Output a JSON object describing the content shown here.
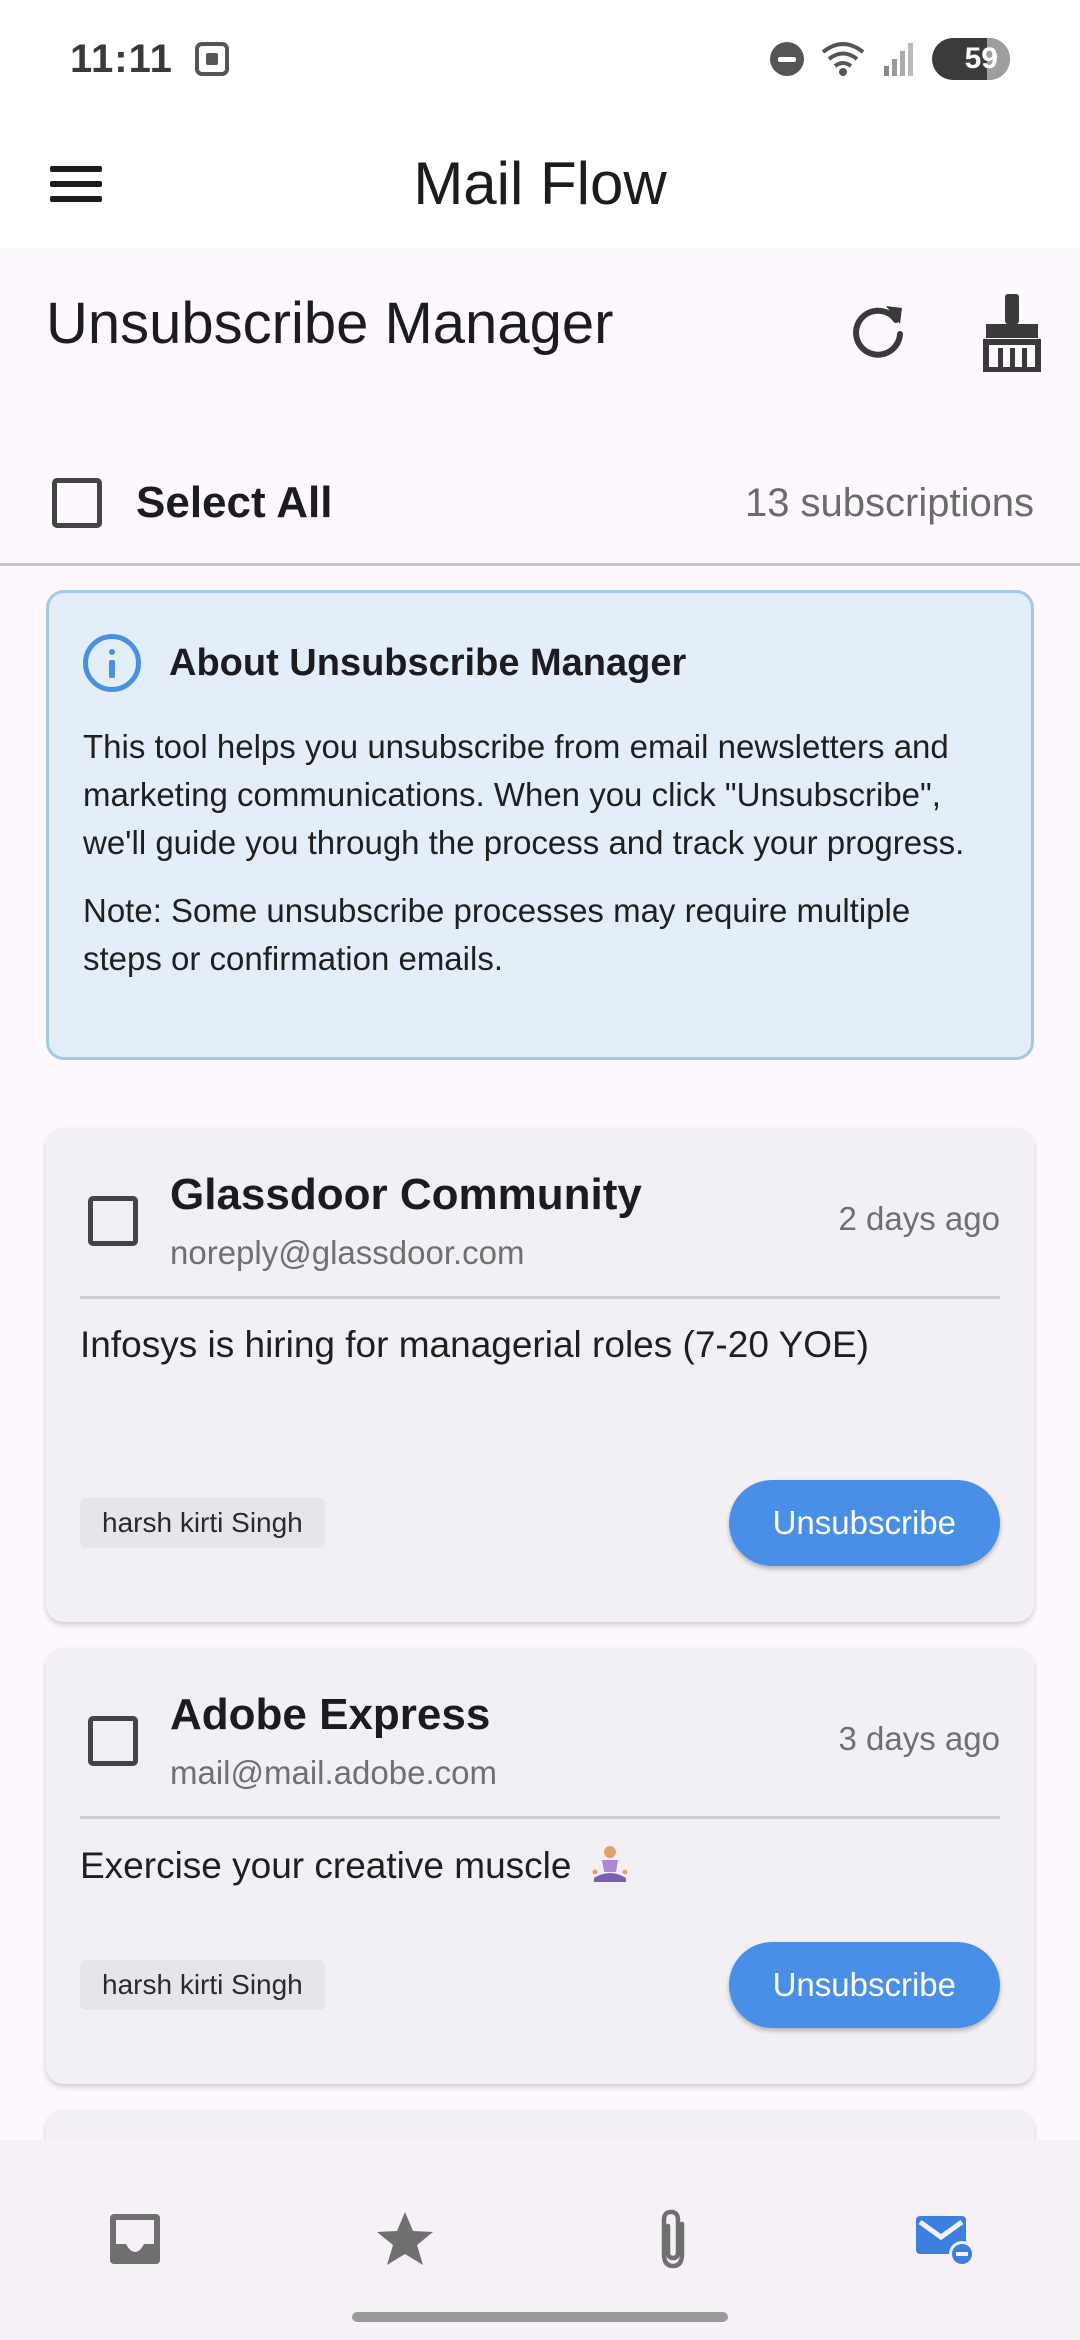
{
  "status_bar": {
    "time": "11:11",
    "battery": "59"
  },
  "app_bar": {
    "title": "Mail Flow"
  },
  "header": {
    "title": "Unsubscribe Manager",
    "select_all_label": "Select All",
    "subscription_count": "13 subscriptions"
  },
  "info": {
    "title": "About Unsubscribe Manager",
    "body": "This tool helps you unsubscribe from email newsletters and marketing communications. When you click \"Unsubscribe\", we'll guide you through the process and track your progress.",
    "note": "Note: Some unsubscribe processes may require multiple steps or confirmation emails."
  },
  "subscriptions": [
    {
      "sender": "Glassdoor Community",
      "email": "noreply@glassdoor.com",
      "date": "2 days ago",
      "subject": "Infosys is hiring for managerial roles (7-20 YOE)",
      "tag": "harsh kirti Singh",
      "action": "Unsubscribe"
    },
    {
      "sender": "Adobe Express",
      "email": "mail@mail.adobe.com",
      "date": "3 days ago",
      "subject": "Exercise your creative muscle",
      "tag": "harsh kirti Singh",
      "action": "Unsubscribe"
    }
  ],
  "bottom_nav": {
    "items": [
      {
        "icon": "inbox-icon",
        "active": false
      },
      {
        "icon": "star-icon",
        "active": false
      },
      {
        "icon": "attachment-icon",
        "active": false
      },
      {
        "icon": "unsubscribe-mail-icon",
        "active": true
      }
    ]
  },
  "colors": {
    "accent": "#4a8fe7",
    "info_background": "#e3eef9",
    "card_background": "#f3f0f5",
    "nav_inactive": "#6f6f6f"
  }
}
